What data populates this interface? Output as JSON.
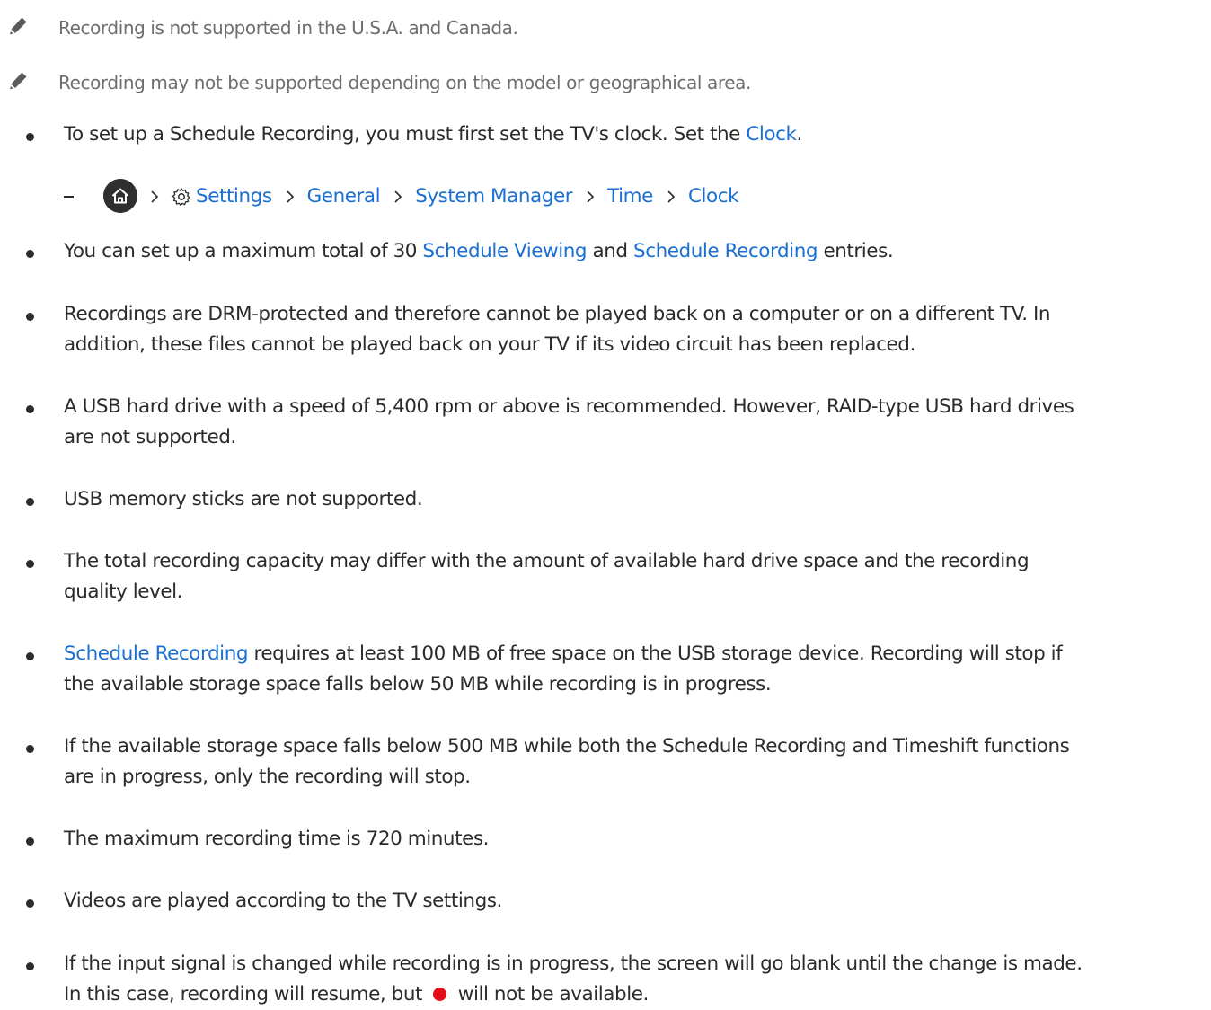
{
  "notes": [
    {
      "text": "Recording is not supported in the U.S.A. and Canada."
    },
    {
      "text": "Recording may not be supported depending on the model or geographical area."
    }
  ],
  "bullets": {
    "b1": {
      "before": "To set up a Schedule Recording, you must first set the TV's clock. Set the ",
      "link": "Clock",
      "after": "."
    },
    "b2": {
      "a": "You can set up a maximum total of 30 ",
      "link1": "Schedule Viewing",
      "b": " and ",
      "link2": "Schedule Recording",
      "c": " entries."
    },
    "b3": {
      "line1": "Recordings are DRM-protected and therefore cannot be played back on a computer or on a different TV. In",
      "line2": "addition, these files cannot be played back on your TV if its video circuit has been replaced."
    },
    "b4": {
      "line1": "A USB hard drive with a speed of 5,400 rpm or above is recommended. However, RAID-type USB hard drives",
      "line2": "are not supported."
    },
    "b5": {
      "line1": "USB memory sticks are not supported."
    },
    "b6": {
      "line1": "The total recording capacity may differ with the amount of available hard drive space and the recording",
      "line2": "quality level."
    },
    "b7": {
      "link": "Schedule Recording",
      "line1_rest": " requires at least 100 MB of free space on the USB storage device. Recording will stop if",
      "line2": "the available storage space falls below 50 MB while recording is in progress."
    },
    "b8": {
      "line1": "If the available storage space falls below 500 MB while both the Schedule Recording and Timeshift functions",
      "line2": "are in progress, only the recording will stop."
    },
    "b9": {
      "line1": "The maximum recording time is 720 minutes."
    },
    "b10": {
      "line1": "Videos are played according to the TV settings."
    },
    "b11": {
      "line1": "If the input signal is changed while recording is in progress, the screen will go blank until the change is made.",
      "line2_a": "In this case, recording will resume, but ",
      "line2_b": " will not be available."
    }
  },
  "menu_path": [
    "Settings",
    "General",
    "System Manager",
    "Time",
    "Clock"
  ],
  "icons": {
    "note": "pencil-icon",
    "home": "home-icon",
    "settings": "gear-icon",
    "separator": "chevron-right-icon",
    "record": "record-dot-icon"
  },
  "colors": {
    "link": "#1a6fd1",
    "text": "#2b2b2b",
    "note_text": "#6e6e6e",
    "record": "#e30d17"
  }
}
